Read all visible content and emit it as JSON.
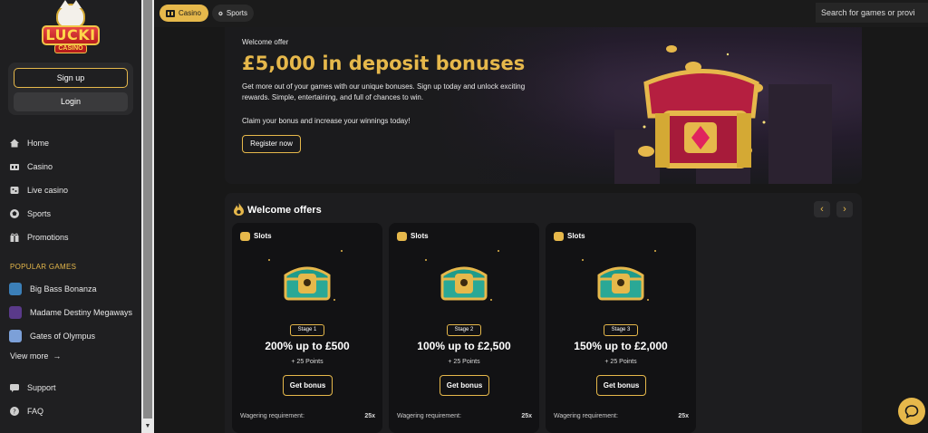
{
  "brand": {
    "logo_word": "LUCKI",
    "logo_sub": "CASINO"
  },
  "auth": {
    "signup_label": "Sign up",
    "login_label": "Login"
  },
  "nav": [
    {
      "label": "Home",
      "icon": "home-icon"
    },
    {
      "label": "Casino",
      "icon": "casino-icon"
    },
    {
      "label": "Live casino",
      "icon": "live-casino-icon"
    },
    {
      "label": "Sports",
      "icon": "sports-icon"
    },
    {
      "label": "Promotions",
      "icon": "gift-icon"
    }
  ],
  "popular": {
    "title": "POPULAR GAMES",
    "games": [
      {
        "label": "Big Bass Bonanza",
        "color": "#3b7fb8"
      },
      {
        "label": "Madame Destiny Megaways",
        "color": "#5a3a8a"
      },
      {
        "label": "Gates of Olympus",
        "color": "#7ca0d8"
      }
    ],
    "view_more": "View more"
  },
  "footer_nav": [
    {
      "label": "Support",
      "icon": "support-icon"
    },
    {
      "label": "FAQ",
      "icon": "faq-icon"
    }
  ],
  "topbar": {
    "tabs": [
      {
        "label": "Casino",
        "icon": "casino-icon",
        "active": true
      },
      {
        "label": "Sports",
        "icon": "sports-icon",
        "active": false
      }
    ],
    "search_placeholder": "Search for games or provi"
  },
  "hero": {
    "label": "Welcome offer",
    "title": "£5,000 in deposit bonuses",
    "description": "Get more out of your games with our unique bonuses. Sign up today and unlock exciting rewards. Simple, entertaining, and full of chances to win.",
    "claim": "Claim your bonus and increase your winnings today!",
    "cta": "Register now"
  },
  "offers": {
    "title": "Welcome offers",
    "cards": [
      {
        "category": "Slots",
        "stage": "Stage 1",
        "amount": "200% up to £500",
        "points": "+ 25 Points",
        "cta": "Get bonus",
        "wager_label": "Wagering requirement:",
        "wager_value": "25x"
      },
      {
        "category": "Slots",
        "stage": "Stage 2",
        "amount": "100% up to £2,500",
        "points": "+ 25 Points",
        "cta": "Get bonus",
        "wager_label": "Wagering requirement:",
        "wager_value": "25x"
      },
      {
        "category": "Slots",
        "stage": "Stage 3",
        "amount": "150% up to £2,000",
        "points": "+ 25 Points",
        "cta": "Get bonus",
        "wager_label": "Wagering requirement:",
        "wager_value": "25x"
      }
    ]
  },
  "colors": {
    "accent": "#e6b84b",
    "background": "#181818",
    "sidebar": "#1f1f21"
  }
}
